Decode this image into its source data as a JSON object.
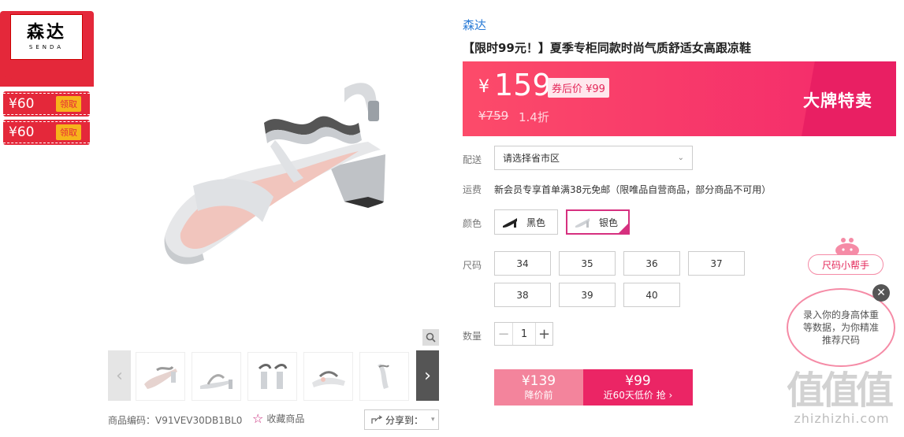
{
  "brand": {
    "logo_cn": "森达",
    "logo_en": "SENDA"
  },
  "coupons": [
    {
      "amount": "¥60",
      "action": "领取"
    },
    {
      "amount": "¥60",
      "action": "领取"
    }
  ],
  "gallery": {
    "prev": "‹",
    "next": "›",
    "sku_label": "商品编码：V91VEV30DB1BL0",
    "favorite_label": "收藏商品",
    "share_label": "分享到："
  },
  "product": {
    "store": "森达",
    "title": "【限时99元！】夏季专柜同款时尚气质舒适女高跟凉鞋"
  },
  "price": {
    "currency": "¥",
    "current": "159",
    "after_coupon": "券后价 ¥99",
    "original": "¥759",
    "discount": "1.4折",
    "promo_tag": "大牌特卖"
  },
  "delivery": {
    "label": "配送",
    "placeholder": "请选择省市区"
  },
  "shipping": {
    "label": "运费",
    "text": "新会员专享首单满38元免邮（限唯品自营商品，部分商品不可用）"
  },
  "color": {
    "label": "颜色",
    "options": [
      {
        "name": "黑色",
        "selected": false
      },
      {
        "name": "银色",
        "selected": true
      }
    ]
  },
  "size": {
    "label": "尺码",
    "options": [
      "34",
      "35",
      "36",
      "37",
      "38",
      "39",
      "40"
    ]
  },
  "quantity": {
    "label": "数量",
    "minus": "−",
    "value": "1",
    "plus": "+"
  },
  "buy": {
    "left_price": "¥139",
    "left_caption": "降价前",
    "right_price": "¥99",
    "right_caption": "近60天低价 抢 ›"
  },
  "size_helper": {
    "title": "尺码小帮手",
    "message": "录入你的身高体重等数据，为你精准推荐尺码"
  },
  "watermark": {
    "glyphs": "值值值",
    "domain": "zhizhizhi.com"
  }
}
